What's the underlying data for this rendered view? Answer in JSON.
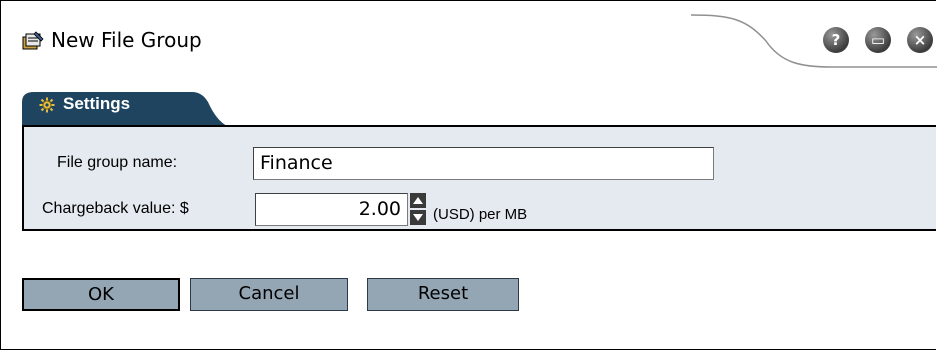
{
  "dialog": {
    "title": "New File Group",
    "title_icon": "file-group-icon",
    "header_buttons": [
      {
        "name": "help",
        "glyph": "?",
        "icon": "help-icon"
      },
      {
        "name": "print",
        "glyph": "▭",
        "icon": "print-icon"
      },
      {
        "name": "close",
        "glyph": "×",
        "icon": "close-icon"
      }
    ]
  },
  "tab": {
    "label": "Settings",
    "icon": "settings-icon",
    "color": "#1e4460"
  },
  "form": {
    "name_label": "File group name:",
    "name_value": "Finance",
    "chargeback_label": "Chargeback value: $",
    "chargeback_value": "2.00",
    "chargeback_unit": "(USD) per MB"
  },
  "buttons": {
    "ok": "OK",
    "cancel": "Cancel",
    "reset": "Reset"
  },
  "colors": {
    "panel_bg": "#e4eaf0",
    "button_bg": "#94a5b3",
    "tab_bg": "#1e4460"
  }
}
